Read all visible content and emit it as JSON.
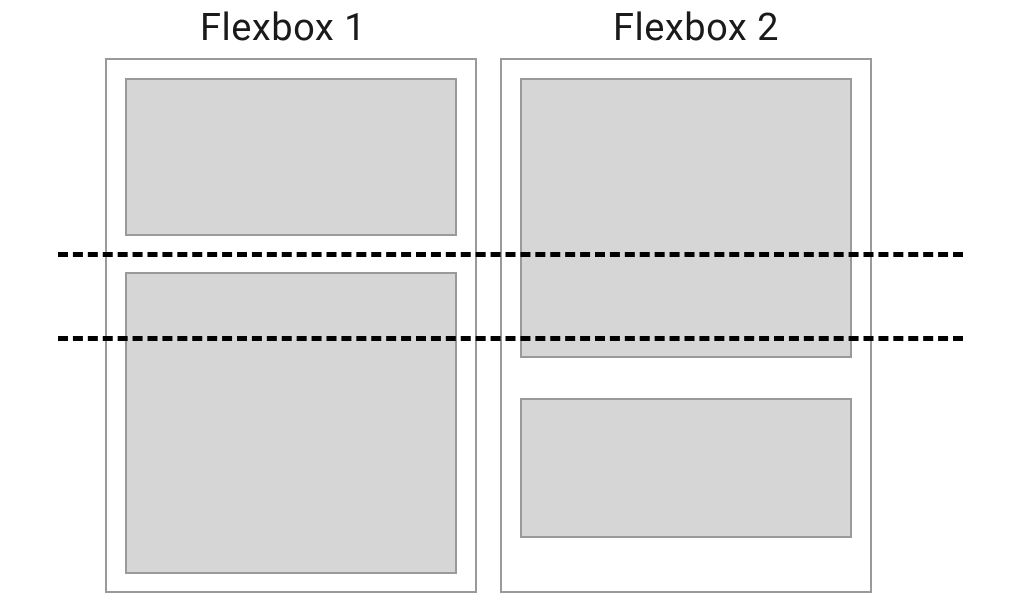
{
  "diagram": {
    "labels": {
      "flexbox1": "Flexbox 1",
      "flexbox2": "Flexbox 2"
    },
    "containers": [
      {
        "name": "flexbox-1",
        "items": [
          {
            "name": "top-item"
          },
          {
            "name": "bottom-item"
          }
        ]
      },
      {
        "name": "flexbox-2",
        "items": [
          {
            "name": "top-item"
          },
          {
            "name": "bottom-item"
          }
        ]
      }
    ],
    "guide_lines": 2
  }
}
